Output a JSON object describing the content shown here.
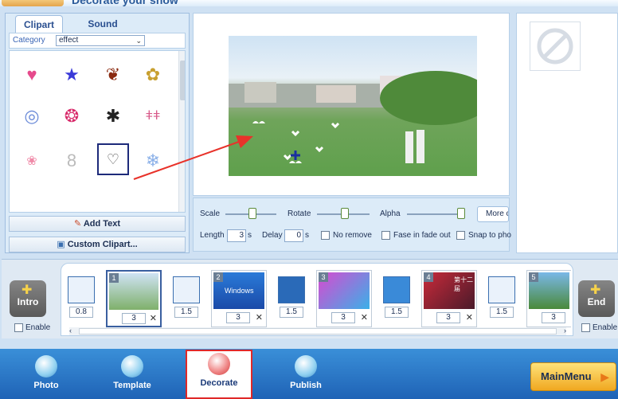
{
  "header": {
    "title": "Decorate your show"
  },
  "clipart_panel": {
    "tabs": [
      "Clipart",
      "Sound"
    ],
    "category_label": "Category",
    "category_value": "effect",
    "buttons": {
      "add_text": "Add Text",
      "custom_clipart": "Custom Clipart..."
    }
  },
  "controls": {
    "scale_label": "Scale",
    "rotate_label": "Rotate",
    "alpha_label": "Alpha",
    "more_label": "More c",
    "length_label": "Length",
    "length_value": "3",
    "length_unit": "s",
    "delay_label": "Delay",
    "delay_value": "0",
    "delay_unit": "s",
    "no_remove": "No remove",
    "fade": "Fase in fade out",
    "snap": "Snap to pho"
  },
  "timeline": {
    "intro_label": "Intro",
    "end_label": "End",
    "enable_label": "Enable",
    "transitions": [
      "0.8",
      "1.5",
      "1.5",
      "1.5",
      "1.5"
    ],
    "slides": [
      {
        "num": "1",
        "duration": "3"
      },
      {
        "num": "2",
        "duration": "3"
      },
      {
        "num": "3",
        "duration": "3"
      },
      {
        "num": "4",
        "duration": "3"
      },
      {
        "num": "5",
        "duration": "3"
      }
    ],
    "slide2_overlay": "Windows",
    "slide4_overlay": "第十二届"
  },
  "nav": {
    "photo": "Photo",
    "template": "Template",
    "decorate": "Decorate",
    "publish": "Publish",
    "main_menu": "MainMenu"
  },
  "colors": {
    "accent": "#1f63b6",
    "highlight_outline": "#e02828",
    "arrow": "#e8322a"
  }
}
